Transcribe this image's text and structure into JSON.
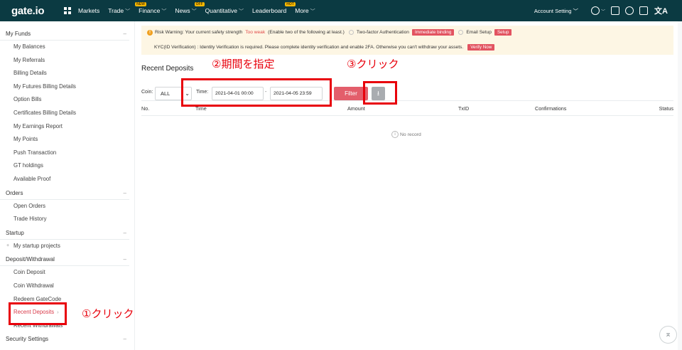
{
  "topnav": {
    "logo": "gate.io",
    "items": [
      {
        "label": "Markets",
        "badge": "",
        "chevron": ""
      },
      {
        "label": "Trade",
        "badge": "",
        "chevron": "﹀"
      },
      {
        "label": "Finance",
        "badge": "NEW",
        "chevron": "﹀"
      },
      {
        "label": "News",
        "badge": "",
        "chevron": "﹀"
      },
      {
        "label": "Quantitative",
        "badge": "OFF",
        "chevron": "﹀"
      },
      {
        "label": "Leaderboard",
        "badge": "",
        "chevron": ""
      },
      {
        "label": "More",
        "badge": "HOT",
        "chevron": "﹀"
      }
    ],
    "account": "Account Setting ﹀",
    "user_chevron": "﹀",
    "translate_glyph": "文A"
  },
  "sidebar": {
    "groups": [
      {
        "label": "My Funds",
        "toggle": "–",
        "items": [
          "My Balances",
          "My Referrals",
          "Billing Details",
          "My Futures Billing Details",
          "Option Bills",
          "Certificates Billing Details",
          "My Earnings Report",
          "My Points",
          "Push Transaction",
          "GT holdings",
          "Available Proof"
        ]
      },
      {
        "label": "Orders",
        "toggle": "–",
        "items": [
          "Open Orders",
          "Trade History"
        ]
      },
      {
        "label": "Startup",
        "toggle": "–",
        "items": [
          "My startup projects"
        ]
      },
      {
        "label": "Deposit/Withdrawal",
        "toggle": "–",
        "items": [
          "Coin Deposit",
          "Coin Withdrawal",
          "Redeem GateCode",
          "Recent Deposits",
          "Recent Withdrawals"
        ]
      },
      {
        "label": "Security Settings",
        "toggle": "–",
        "items": []
      }
    ],
    "active_arrow": "›",
    "startup_plus": "+"
  },
  "warning": {
    "icon": "!",
    "risk_text": "Risk Warning: Your current safety strength",
    "strength": "Too weak",
    "hint": "(Enable two of the following at least.)",
    "twofa_label": "Two-factor Authentication",
    "twofa_button": "Immediate binding",
    "email_label": "Email Setup",
    "email_button": "Setup",
    "kyc_text": "KYC(ID Verification) : Identity Verification is required. Please complete identity verification and enable 2FA. Otherwise you can't withdraw your assets.",
    "kyc_button": "Verify Now"
  },
  "main": {
    "title": "Recent Deposits",
    "coin_label": "Coin:",
    "coin_value": "ALL",
    "coin_dropdown": "⌄",
    "time_label": "Time:",
    "date_from": "2021-04-01 00:00",
    "date_sep": "-",
    "date_to": "2021-04-05 23:59",
    "filter_button": "Filter",
    "download_glyph": "⭳",
    "columns": [
      "No.",
      "Time",
      "Amount",
      "TxID",
      "Confirmations",
      "Status"
    ],
    "info_glyph": "i",
    "empty_text": "No record"
  },
  "annotations": {
    "step1": "①クリック",
    "step2": "②期間を指定",
    "step3": "③クリック",
    "color": "#e8000b"
  },
  "scroll_top_glyph": "⌅",
  "colors": {
    "nav_bg": "#0b3a42",
    "accent_red": "#e35e6b",
    "annotation": "#e8000b",
    "warning_bg": "#fdf6e4"
  }
}
